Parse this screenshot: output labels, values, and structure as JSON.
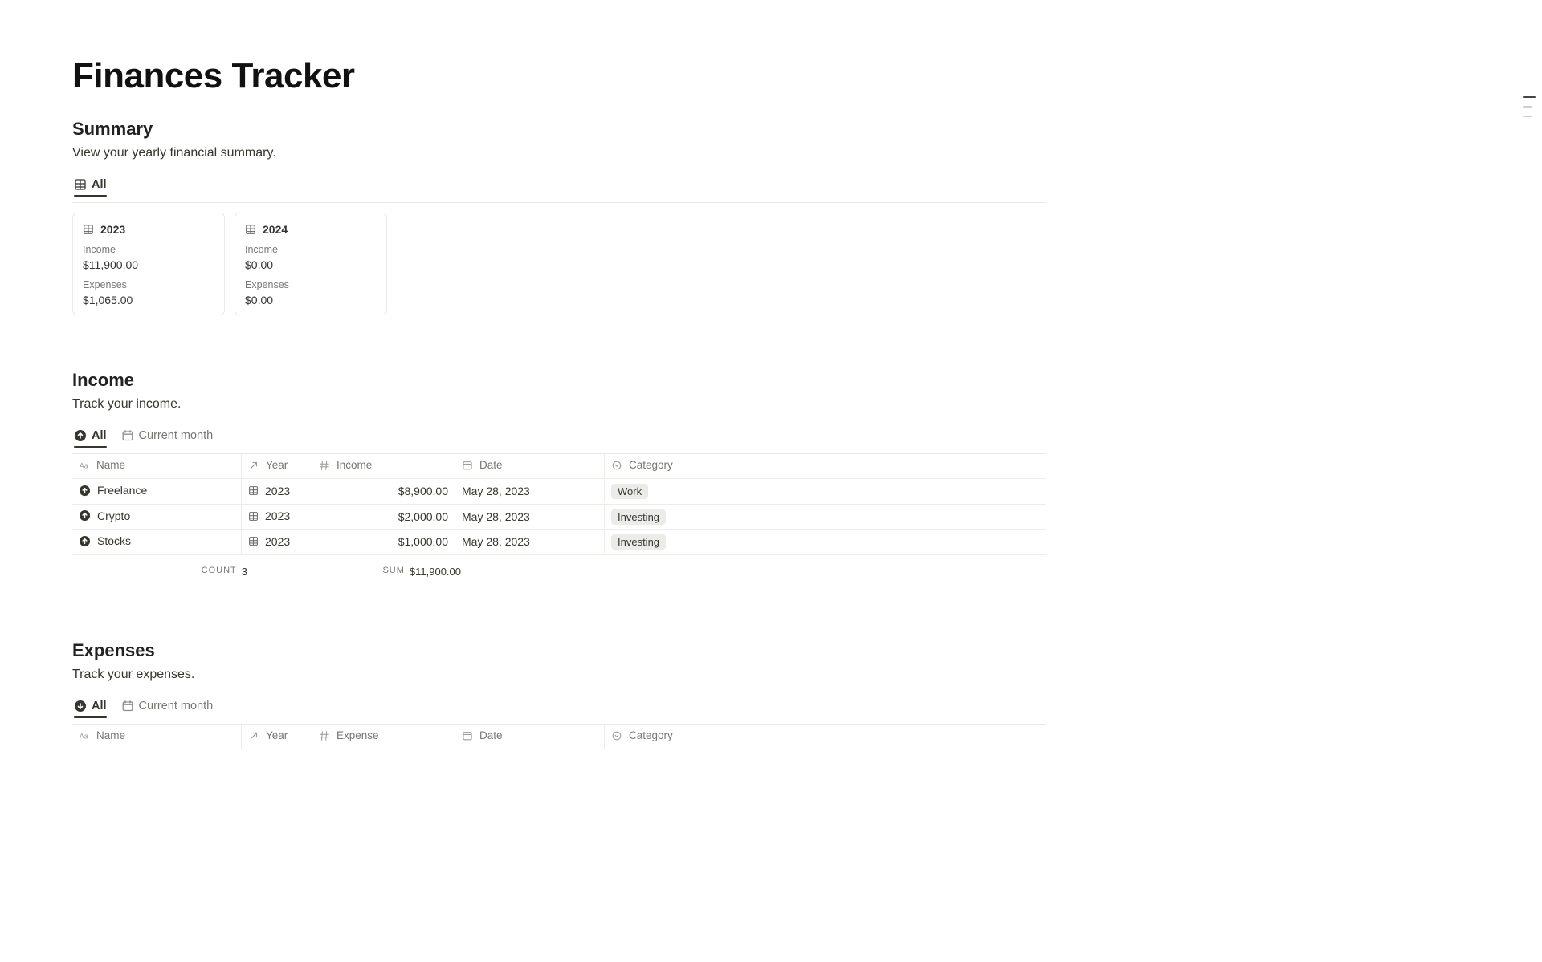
{
  "page_title": "Finances Tracker",
  "summary": {
    "heading": "Summary",
    "desc": "View your yearly financial summary.",
    "tabs": {
      "all": "All"
    },
    "cards": [
      {
        "year": "2023",
        "income_label": "Income",
        "income": "$11,900.00",
        "expenses_label": "Expenses",
        "expenses": "$1,065.00"
      },
      {
        "year": "2024",
        "income_label": "Income",
        "income": "$0.00",
        "expenses_label": "Expenses",
        "expenses": "$0.00"
      }
    ]
  },
  "income": {
    "heading": "Income",
    "desc": "Track your income.",
    "tabs": {
      "all": "All",
      "current_month": "Current month"
    },
    "columns": {
      "name": "Name",
      "year": "Year",
      "amount": "Income",
      "date": "Date",
      "category": "Category"
    },
    "rows": [
      {
        "name": "Freelance",
        "year": "2023",
        "amount": "$8,900.00",
        "date": "May 28, 2023",
        "category": "Work"
      },
      {
        "name": "Crypto",
        "year": "2023",
        "amount": "$2,000.00",
        "date": "May 28, 2023",
        "category": "Investing"
      },
      {
        "name": "Stocks",
        "year": "2023",
        "amount": "$1,000.00",
        "date": "May 28, 2023",
        "category": "Investing"
      }
    ],
    "agg": {
      "count_label": "count",
      "count": "3",
      "sum_label": "sum",
      "sum": "$11,900.00"
    }
  },
  "expenses": {
    "heading": "Expenses",
    "desc": "Track your expenses.",
    "tabs": {
      "all": "All",
      "current_month": "Current month"
    },
    "columns": {
      "name": "Name",
      "year": "Year",
      "amount": "Expense",
      "date": "Date",
      "category": "Category"
    }
  }
}
